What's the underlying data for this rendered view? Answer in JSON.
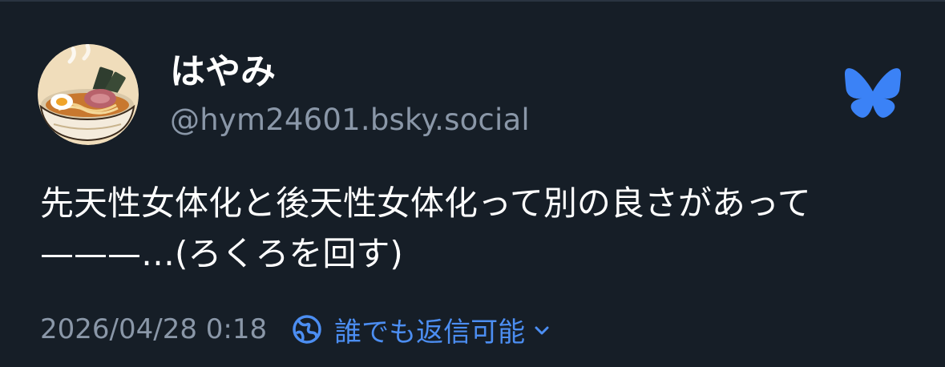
{
  "author": {
    "display_name": "はやみ",
    "handle": "@hym24601.bsky.social",
    "avatar_icon": "ramen-bowl-avatar"
  },
  "post": {
    "text": "先天性女体化と後天性女体化って別の良さがあって———…(ろくろを回す)"
  },
  "meta": {
    "timestamp": "2026/04/28 0:18",
    "reply_setting_label": "誰でも返信可能",
    "reply_setting_icon": "globe-icon"
  },
  "brand": {
    "logo_icon": "bluesky-butterfly-icon",
    "accent_color": "#3b82f6"
  },
  "colors": {
    "background": "#161e27",
    "primary_text": "#ffffff",
    "secondary_text": "#8a97a8",
    "link": "#4c8ef2"
  }
}
